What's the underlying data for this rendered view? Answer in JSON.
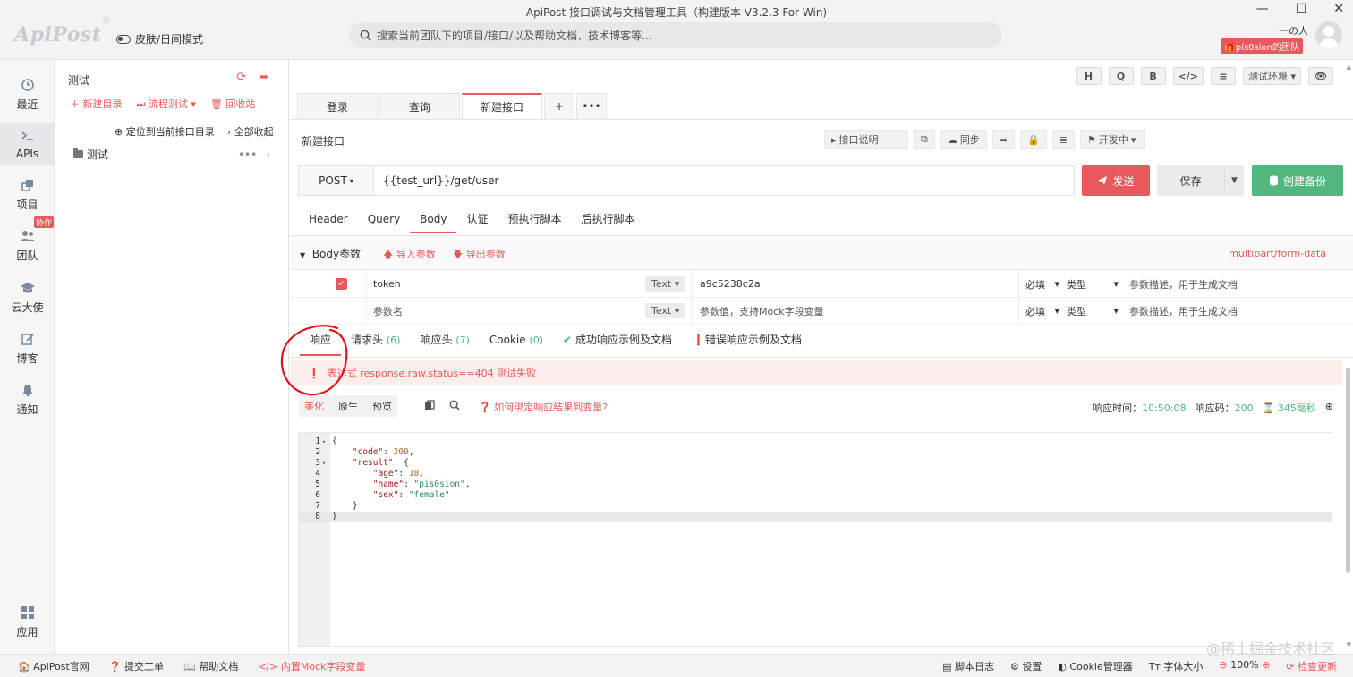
{
  "window": {
    "title": "ApiPost 接口调试与文档管理工具（构建版本 V3.2.3 For Win)"
  },
  "header": {
    "logo": "ApiPost",
    "logo_mark": "®",
    "theme_toggle": "皮肤/日间模式",
    "search_placeholder": "搜索当前团队下的项目/接口/以及帮助文档、技术博客等...",
    "user_name": "一の人",
    "team_badge": "pis0sion的团队"
  },
  "leftnav": {
    "items": [
      {
        "label": "最近",
        "icon": "clock-icon"
      },
      {
        "label": "APIs",
        "icon": "terminal-icon"
      },
      {
        "label": "项目",
        "icon": "project-icon"
      },
      {
        "label": "团队",
        "icon": "team-icon",
        "badge": "协作"
      },
      {
        "label": "云大使",
        "icon": "graduation-cap-icon"
      },
      {
        "label": "博客",
        "icon": "edit-icon"
      },
      {
        "label": "通知",
        "icon": "bell-icon"
      },
      {
        "label": "应用",
        "icon": "grid-icon"
      }
    ]
  },
  "tree": {
    "title": "测试",
    "actions": {
      "new_dir": "新建目录",
      "flow_test": "流程测试",
      "recycle": "回收站"
    },
    "locate": "定位到当前接口目录",
    "collapse_all": "全部收起",
    "folders": [
      {
        "name": "测试"
      }
    ]
  },
  "toolbar": {
    "buttons": [
      "H",
      "Q",
      "B",
      "</>",
      "≡"
    ],
    "env": "测试环境",
    "eye": "👁"
  },
  "tabs": {
    "items": [
      "登录",
      "查询",
      "新建接口"
    ],
    "active_index": 2,
    "add": "+",
    "more": "•••"
  },
  "api": {
    "name": "新建接口",
    "tools": {
      "doc": "接口说明",
      "sync": "同步",
      "status": "开发中"
    },
    "method": "POST",
    "url": "{{test_url}}/get/user",
    "send": "发送",
    "save": "保存",
    "backup": "创建备份"
  },
  "subtabs": {
    "items": [
      "Header",
      "Query",
      "Body",
      "认证",
      "预执行脚本",
      "后执行脚本"
    ],
    "active": "Body"
  },
  "body": {
    "title": "Body参数",
    "import": "导入参数",
    "export": "导出参数",
    "content_type": "multipart/form-data",
    "rows": [
      {
        "checked": true,
        "key": "token",
        "type": "Text",
        "value": "a9c5238c2a",
        "required": "必填",
        "vtype": "类型",
        "desc": "参数描述，用于生成文档"
      },
      {
        "checked": false,
        "key": "参数名",
        "type": "Text",
        "value": "参数值，支持Mock字段变量",
        "required": "必填",
        "vtype": "类型",
        "desc": "参数描述，用于生成文档"
      }
    ]
  },
  "response": {
    "tabs": [
      {
        "label": "响应",
        "count": ""
      },
      {
        "label": "请求头",
        "count": "(6)"
      },
      {
        "label": "响应头",
        "count": "(7)"
      },
      {
        "label": "Cookie",
        "count": "(0)"
      },
      {
        "label": "成功响应示例及文档",
        "count": ""
      },
      {
        "label": "错误响应示例及文档",
        "count": ""
      }
    ],
    "error": "表达式 response.raw.status==404 测试失败",
    "views": [
      "美化",
      "原生",
      "预览"
    ],
    "bind_tip": "如何绑定响应结果到变量?",
    "time_label": "响应时间：",
    "time": "10:50:08",
    "code_label": "响应码：",
    "code": "200",
    "duration": "345毫秒",
    "lines": [
      {
        "n": "1",
        "fold": "▾",
        "html": "{"
      },
      {
        "n": "2",
        "fold": "",
        "key": "code",
        "val": "200",
        "vt": "n",
        "ind": 1,
        "comma": true
      },
      {
        "n": "3",
        "fold": "▾",
        "key": "result",
        "open": "{",
        "ind": 1
      },
      {
        "n": "4",
        "fold": "",
        "key": "age",
        "val": "18",
        "vt": "n",
        "ind": 2,
        "comma": true
      },
      {
        "n": "5",
        "fold": "",
        "key": "name",
        "val": "\"pis0sion\"",
        "vt": "s",
        "ind": 2,
        "comma": true
      },
      {
        "n": "6",
        "fold": "",
        "key": "sex",
        "val": "\"female\"",
        "vt": "s",
        "ind": 2,
        "comma": false
      },
      {
        "n": "7",
        "fold": "",
        "close": "}",
        "ind": 1
      },
      {
        "n": "8",
        "fold": "",
        "close": "}",
        "ind": 0,
        "hl": true
      }
    ]
  },
  "statusbar": {
    "left": [
      "ApiPost官网",
      "提交工单",
      "帮助文档",
      "内置Mock字段变量"
    ],
    "right": [
      "脚本日志",
      "设置",
      "Cookie管理器",
      "字体大小",
      "100%",
      "检查更新"
    ]
  },
  "watermark": "@稀土掘金技术社区",
  "colors": {
    "accent": "#e8595b",
    "success": "#52b77f",
    "annotation": "#e0141e"
  }
}
